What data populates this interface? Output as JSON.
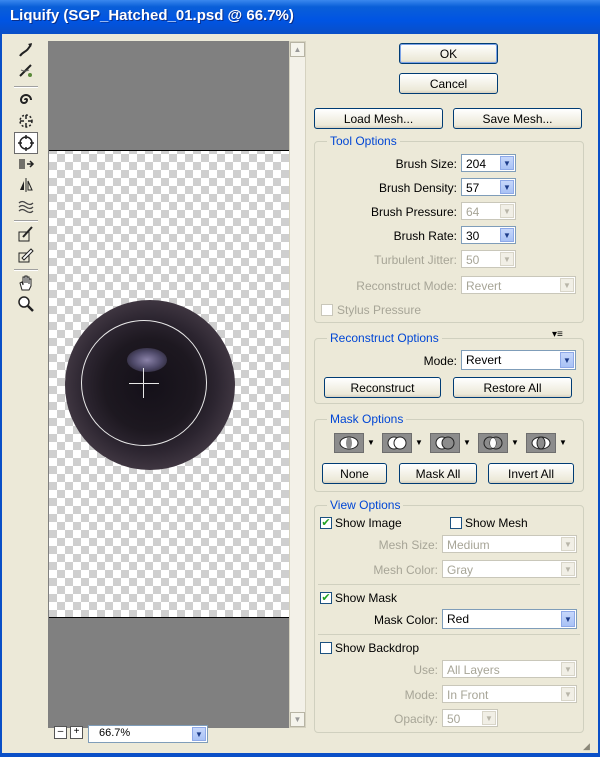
{
  "window": {
    "title": "Liquify (SGP_Hatched_01.psd @ 66.7%)"
  },
  "tools": [
    "forward-warp-icon",
    "reconstruct-icon",
    "twirl-icon",
    "pucker-icon",
    "bloat-icon",
    "push-left-icon",
    "mirror-icon",
    "turbulence-icon",
    "freeze-mask-icon",
    "thaw-mask-icon",
    "hand-icon",
    "zoom-icon"
  ],
  "preview": {
    "zoom": "66.7%",
    "zoom_minus": "–",
    "zoom_plus": "+"
  },
  "buttons": {
    "ok": "OK",
    "cancel": "Cancel",
    "load_mesh": "Load Mesh...",
    "save_mesh": "Save Mesh..."
  },
  "tool_options": {
    "title": "Tool Options",
    "brush_size": {
      "label": "Brush Size:",
      "value": "204"
    },
    "brush_density": {
      "label": "Brush Density:",
      "value": "57"
    },
    "brush_pressure": {
      "label": "Brush Pressure:",
      "value": "64"
    },
    "brush_rate": {
      "label": "Brush Rate:",
      "value": "30"
    },
    "turbulent_jitter": {
      "label": "Turbulent Jitter:",
      "value": "50"
    },
    "reconstruct_mode": {
      "label": "Reconstruct Mode:",
      "value": "Revert"
    },
    "stylus_pressure": {
      "label": "Stylus Pressure",
      "checked": false
    }
  },
  "reconstruct_options": {
    "title": "Reconstruct Options",
    "mode": {
      "label": "Mode:",
      "value": "Revert"
    },
    "reconstruct": "Reconstruct",
    "restore_all": "Restore All"
  },
  "mask_options": {
    "title": "Mask Options",
    "none": "None",
    "mask_all": "Mask All",
    "invert_all": "Invert All"
  },
  "view_options": {
    "title": "View Options",
    "show_image": {
      "label": "Show Image",
      "checked": true
    },
    "show_mesh": {
      "label": "Show Mesh",
      "checked": false
    },
    "mesh_size": {
      "label": "Mesh Size:",
      "value": "Medium"
    },
    "mesh_color": {
      "label": "Mesh Color:",
      "value": "Gray"
    },
    "show_mask": {
      "label": "Show Mask",
      "checked": true
    },
    "mask_color": {
      "label": "Mask Color:",
      "value": "Red"
    },
    "show_backdrop": {
      "label": "Show Backdrop",
      "checked": false
    },
    "use": {
      "label": "Use:",
      "value": "All Layers"
    },
    "mode": {
      "label": "Mode:",
      "value": "In Front"
    },
    "opacity": {
      "label": "Opacity:",
      "value": "50"
    }
  },
  "colors": {
    "title_bar": "#0054e3",
    "group_title": "#0046d5",
    "dialog_bg": "#ece9d8",
    "check": "#21a121"
  }
}
